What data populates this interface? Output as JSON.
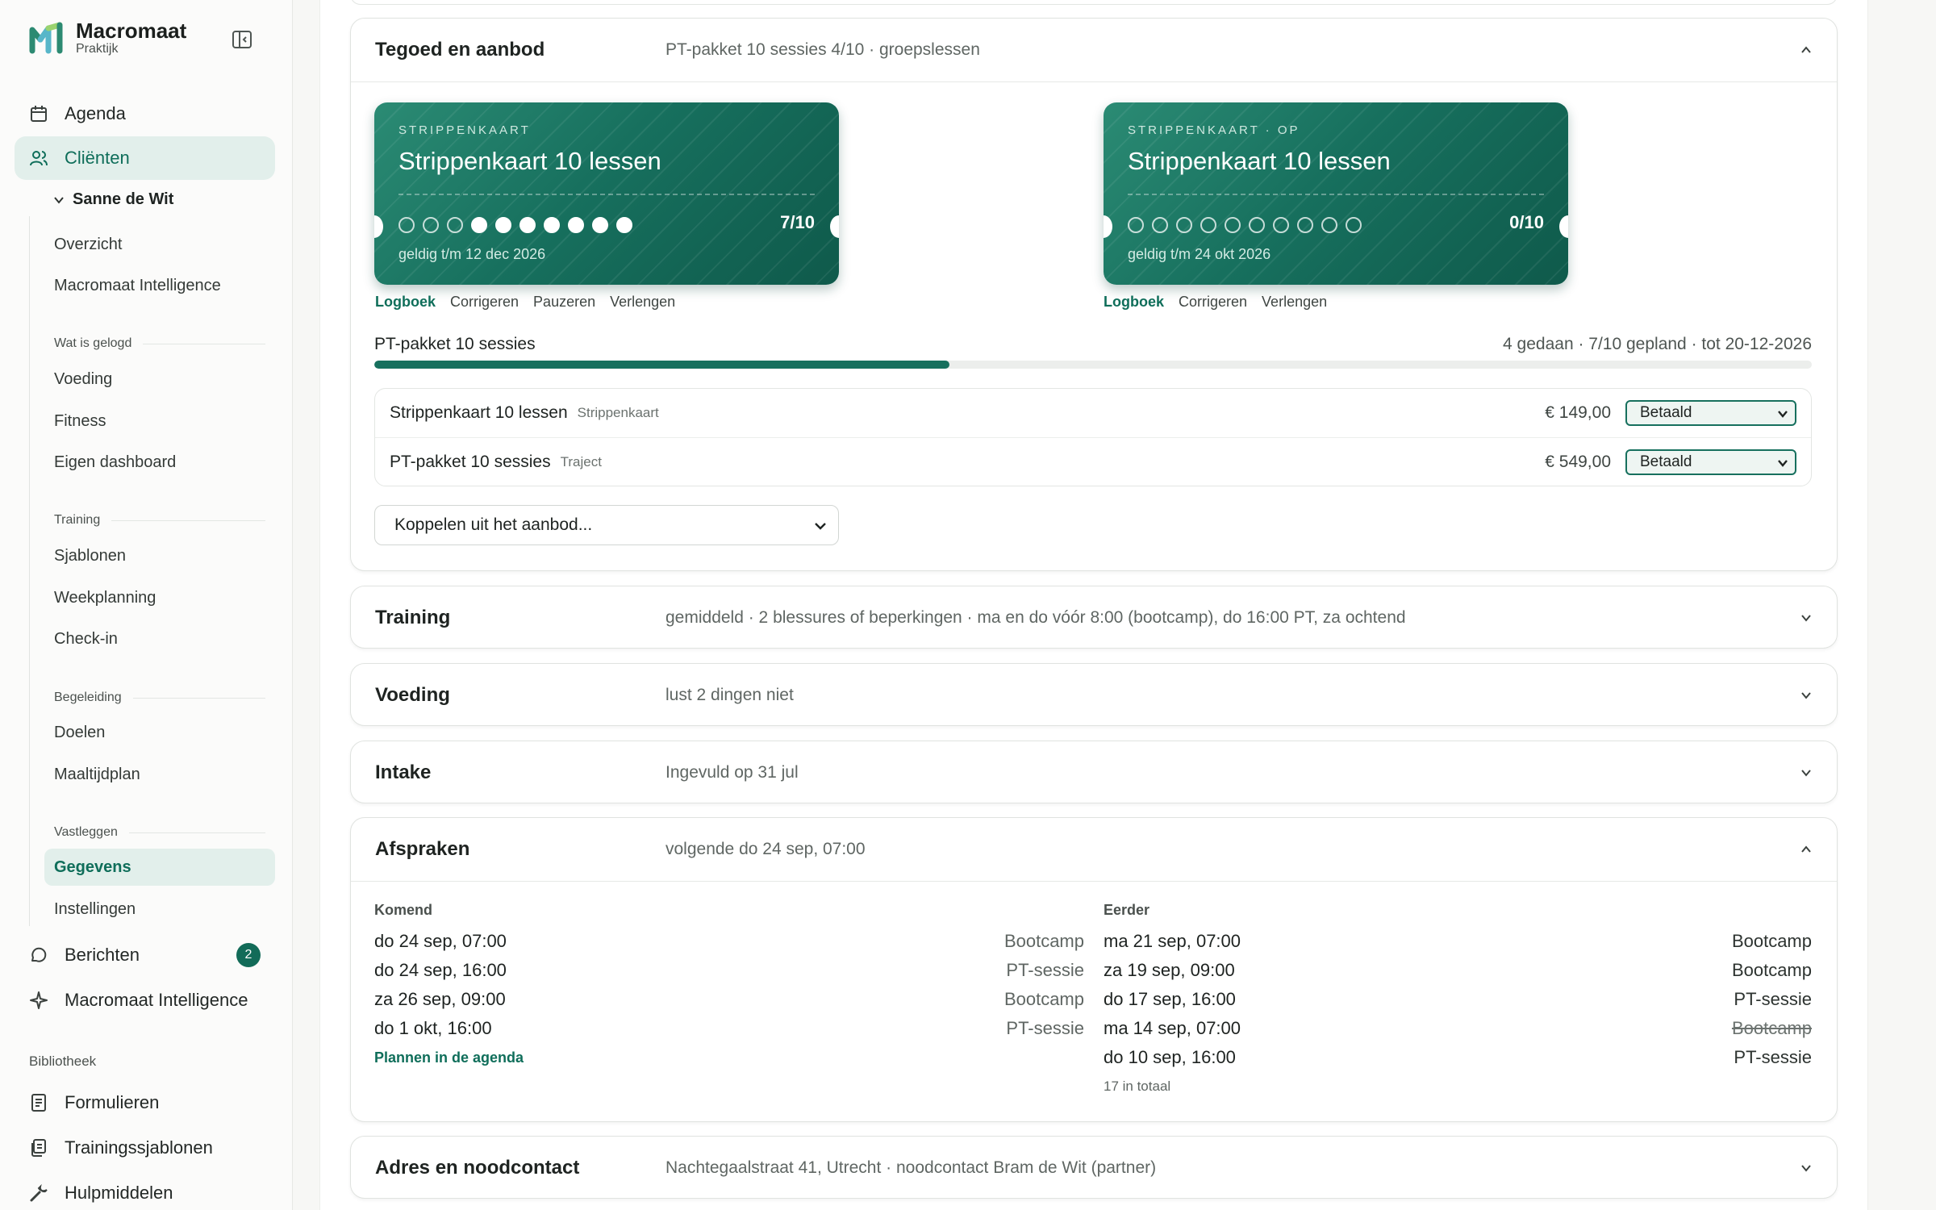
{
  "app": {
    "name": "Macromaat",
    "subtitle": "Praktijk"
  },
  "nav": {
    "agenda": "Agenda",
    "clients": "Cliënten",
    "client_name": "Sanne de Wit",
    "client_items": {
      "overview": "Overzicht",
      "intelligence": "Macromaat Intelligence",
      "group_logged": "Wat is gelogd",
      "voeding": "Voeding",
      "fitness": "Fitness",
      "dashboard": "Eigen dashboard",
      "group_training": "Training",
      "sjablonen": "Sjablonen",
      "weekplanning": "Weekplanning",
      "checkin": "Check-in",
      "group_guidance": "Begeleiding",
      "doelen": "Doelen",
      "maaltijdplan": "Maaltijdplan",
      "group_record": "Vastleggen",
      "gegevens": "Gegevens",
      "instellingen": "Instellingen"
    },
    "berichten": "Berichten",
    "berichten_badge": "2",
    "intelligence": "Macromaat Intelligence",
    "library_label": "Bibliotheek",
    "formulieren": "Formulieren",
    "trainingssjablonen": "Trainingssjablonen",
    "hulpmiddelen": "Hulpmiddelen"
  },
  "tegoed": {
    "title": "Tegoed en aanbod",
    "summary": "PT-pakket 10 sessies 4/10 · groepslessen",
    "tickets": [
      {
        "kicker": "STRIPPENKAART",
        "title": "Strippenkaart 10 lessen",
        "count": "7/10",
        "used": 7,
        "total": 10,
        "valid": "geldig t/m 12 dec 2026",
        "actions": [
          "Logboek",
          "Corrigeren",
          "Pauzeren",
          "Verlengen"
        ]
      },
      {
        "kicker": "STRIPPENKAART · OP",
        "title": "Strippenkaart 10 lessen",
        "count": "0/10",
        "used": 0,
        "total": 10,
        "valid": "geldig t/m 24 okt 2026",
        "actions": [
          "Logboek",
          "Corrigeren",
          "Verlengen"
        ]
      }
    ],
    "package": {
      "name": "PT-pakket 10 sessies",
      "meta": "4 gedaan · 7/10 gepland · tot 20-12-2026",
      "progress": 0.4
    },
    "lines": [
      {
        "name": "Strippenkaart 10 lessen",
        "type": "Strippenkaart",
        "price": "€ 149,00",
        "status": "Betaald"
      },
      {
        "name": "PT-pakket 10 sessies",
        "type": "Traject",
        "price": "€ 549,00",
        "status": "Betaald"
      }
    ],
    "link_select": "Koppelen uit het aanbod..."
  },
  "training": {
    "title": "Training",
    "summary": "gemiddeld · 2 blessures of beperkingen · ma en do vóór 8:00 (bootcamp), do 16:00 PT, za ochtend"
  },
  "voeding": {
    "title": "Voeding",
    "summary": "lust 2 dingen niet"
  },
  "intake": {
    "title": "Intake",
    "summary": "Ingevuld op 31 jul"
  },
  "afspraken": {
    "title": "Afspraken",
    "summary": "volgende do 24 sep, 07:00",
    "upcoming_label": "Komend",
    "past_label": "Eerder",
    "upcoming": [
      {
        "date": "do 24 sep, 07:00",
        "type": "Bootcamp"
      },
      {
        "date": "do 24 sep, 16:00",
        "type": "PT-sessie"
      },
      {
        "date": "za 26 sep, 09:00",
        "type": "Bootcamp"
      },
      {
        "date": "do 1 okt, 16:00",
        "type": "PT-sessie"
      }
    ],
    "past": [
      {
        "date": "ma 21 sep, 07:00",
        "type": "Bootcamp",
        "cancelled": false
      },
      {
        "date": "za 19 sep, 09:00",
        "type": "Bootcamp",
        "cancelled": false
      },
      {
        "date": "do 17 sep, 16:00",
        "type": "PT-sessie",
        "cancelled": false
      },
      {
        "date": "ma 14 sep, 07:00",
        "type": "Bootcamp",
        "cancelled": true
      },
      {
        "date": "do 10 sep, 16:00",
        "type": "PT-sessie",
        "cancelled": false
      }
    ],
    "plan_link": "Plannen in de agenda",
    "total": "17 in totaal"
  },
  "adres": {
    "title": "Adres en noodcontact",
    "summary": "Nachtegaalstraat 41, Utrecht · noodcontact Bram de Wit (partner)"
  },
  "colors": {
    "accent": "#17705e",
    "accent_light": "#e2efeb"
  }
}
